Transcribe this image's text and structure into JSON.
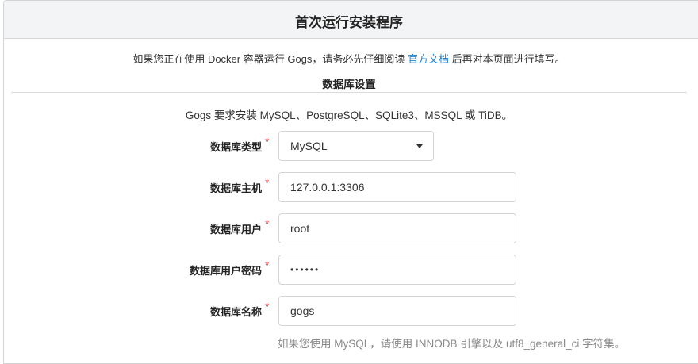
{
  "header": {
    "title": "首次运行安装程序"
  },
  "notice": {
    "before": "如果您正在使用 Docker 容器运行 Gogs，请务必先仔细阅读 ",
    "link": "官方文档",
    "after": " 后再对本页面进行填写。"
  },
  "database": {
    "section_title": "数据库设置",
    "requirement": "Gogs 要求安装 MySQL、PostgreSQL、SQLite3、MSSQL 或 TiDB。",
    "fields": {
      "type": {
        "label": "数据库类型",
        "required_mark": "*",
        "value": "MySQL"
      },
      "host": {
        "label": "数据库主机",
        "required_mark": "*",
        "value": "127.0.0.1:3306"
      },
      "user": {
        "label": "数据库用户",
        "required_mark": "*",
        "value": "root"
      },
      "password": {
        "label": "数据库用户密码",
        "required_mark": "*",
        "value": "••••••"
      },
      "name": {
        "label": "数据库名称",
        "required_mark": "*",
        "value": "gogs"
      }
    },
    "name_help": "如果您使用 MySQL，请使用 INNODB 引擎以及 utf8_general_ci 字符集。"
  }
}
